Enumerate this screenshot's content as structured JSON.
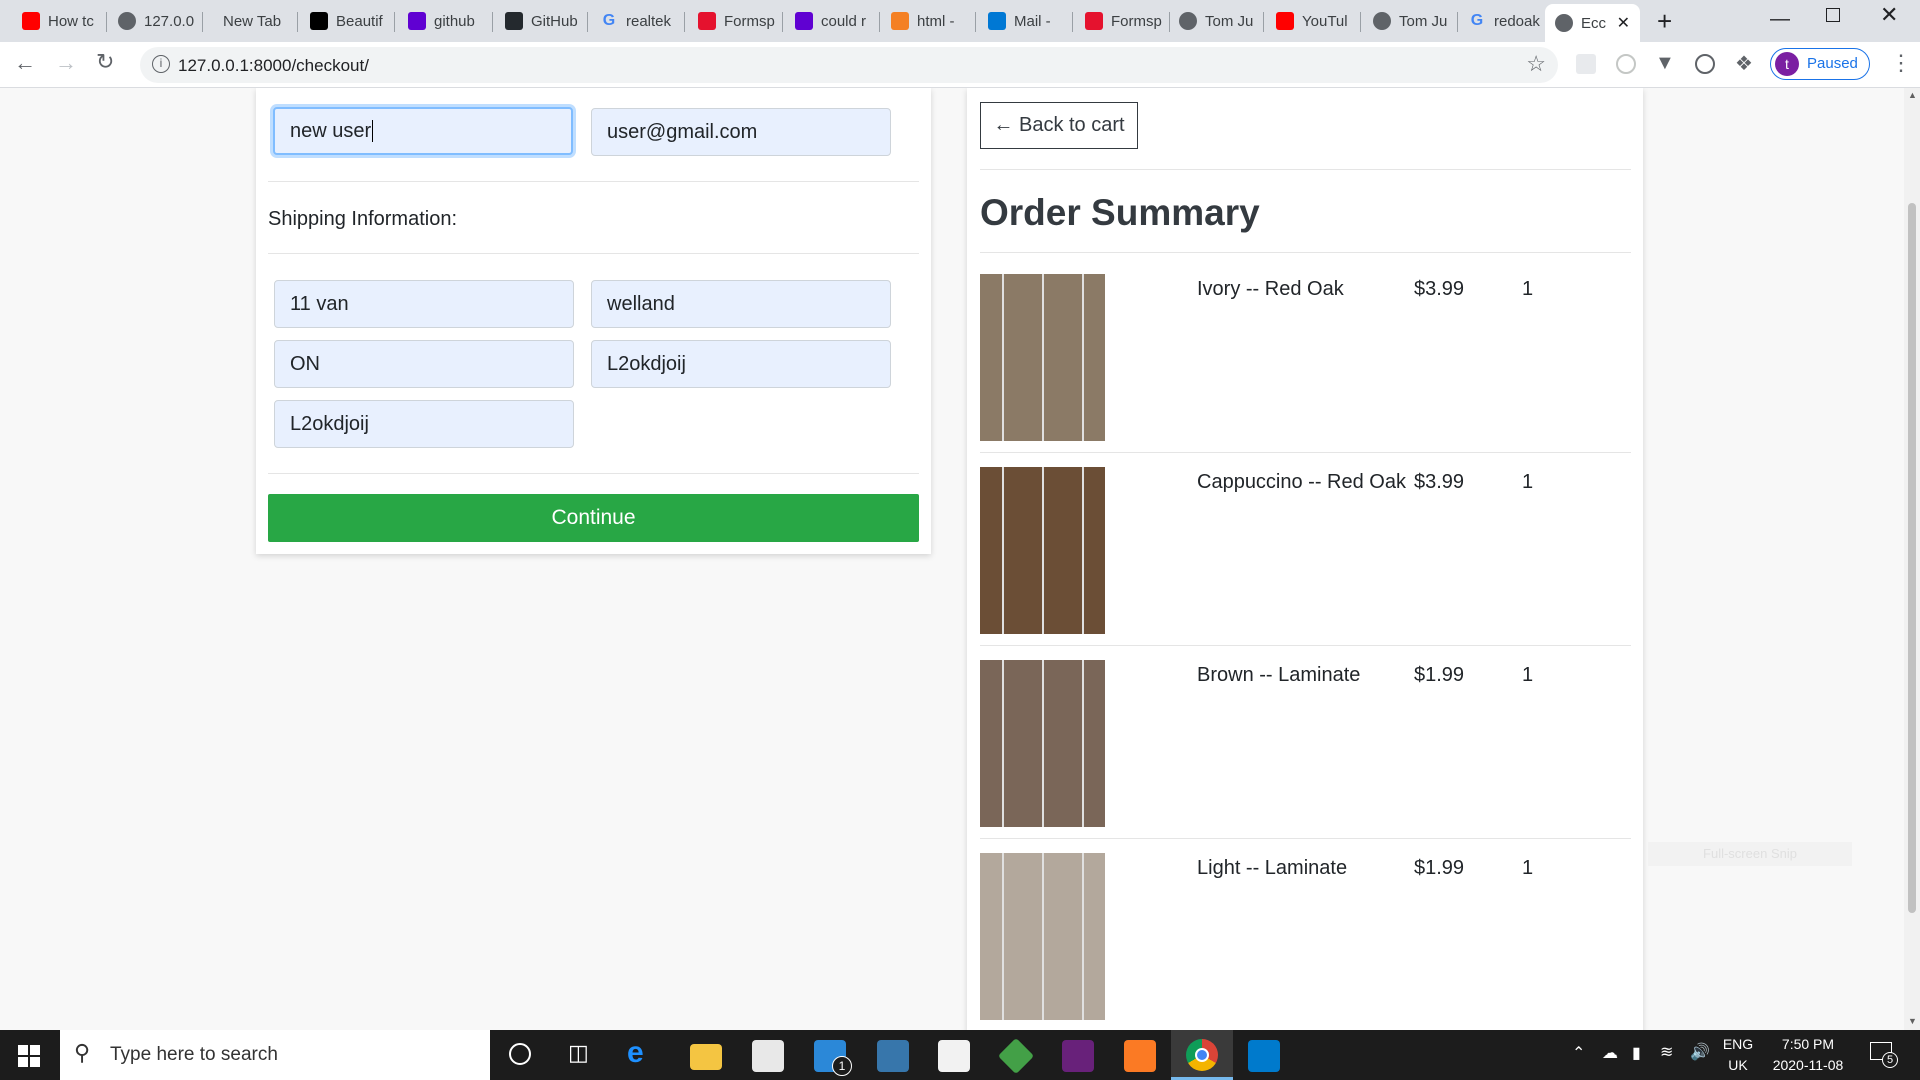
{
  "browser": {
    "tabs": [
      {
        "label": "How tc",
        "favicon": "youtube-icon",
        "color": "#ff0000"
      },
      {
        "label": "127.0.0",
        "favicon": "globe-icon",
        "color": "#5f6368"
      },
      {
        "label": "New Tab",
        "favicon": "",
        "color": ""
      },
      {
        "label": "Beautif",
        "favicon": "unsplash-icon",
        "color": "#000000"
      },
      {
        "label": "github",
        "favicon": "yahoo-icon",
        "color": "#6001d2"
      },
      {
        "label": "GitHub",
        "favicon": "github-icon",
        "color": "#24292e"
      },
      {
        "label": "realtek",
        "favicon": "google-icon",
        "color": "#4285f4"
      },
      {
        "label": "Formsp",
        "favicon": "formspree-icon",
        "color": "#e5122e"
      },
      {
        "label": "could r",
        "favicon": "yahoo-icon",
        "color": "#6001d2"
      },
      {
        "label": "html -",
        "favicon": "stackoverflow-icon",
        "color": "#f48024"
      },
      {
        "label": "Mail - ",
        "favicon": "outlook-icon",
        "color": "#0078d4"
      },
      {
        "label": "Formsp",
        "favicon": "formspree-icon",
        "color": "#e5122e"
      },
      {
        "label": "Tom Ju",
        "favicon": "globe-icon",
        "color": "#5f6368"
      },
      {
        "label": "YouTul",
        "favicon": "youtube-icon",
        "color": "#ff0000"
      },
      {
        "label": "Tom Ju",
        "favicon": "globe-icon",
        "color": "#5f6368"
      },
      {
        "label": "redoak",
        "favicon": "google-icon",
        "color": "#4285f4"
      },
      {
        "label": "Ecc",
        "favicon": "globe-icon",
        "color": "#5f6368",
        "active": true
      }
    ],
    "url": "127.0.0.1:8000/checkout/",
    "profile_label": "Paused",
    "profile_initial": "t"
  },
  "form": {
    "name_value": "new user",
    "email_value": "user@gmail.com",
    "shipping_label": "Shipping Information:",
    "address_value": "11 van",
    "city_value": "welland",
    "state_value": "ON",
    "zipcode_value": "L2okdjoij",
    "country_value": "L2okdjoij",
    "continue_label": "Continue"
  },
  "summary": {
    "back_label": "← Back to cart",
    "title": "Order Summary",
    "items": [
      {
        "name": "Ivory -- Red Oak",
        "price": "$3.99",
        "qty": "1",
        "img_color": "#8b7a66"
      },
      {
        "name": "Cappuccino -- Red Oak",
        "price": "$3.99",
        "qty": "1",
        "img_color": "#6b4e36"
      },
      {
        "name": "Brown -- Laminate",
        "price": "$1.99",
        "qty": "1",
        "img_color": "#7a6658"
      },
      {
        "name": "Light -- Laminate",
        "price": "$1.99",
        "qty": "1",
        "img_color": "#b3a89c"
      }
    ]
  },
  "overlay_hint": "Full-screen Snip",
  "taskbar": {
    "search_placeholder": "Type here to search",
    "lang_top": "ENG",
    "lang_bottom": "UK",
    "time": "7:50 PM",
    "date": "2020-11-08",
    "mail_badge": "1",
    "notification_count": "5"
  }
}
